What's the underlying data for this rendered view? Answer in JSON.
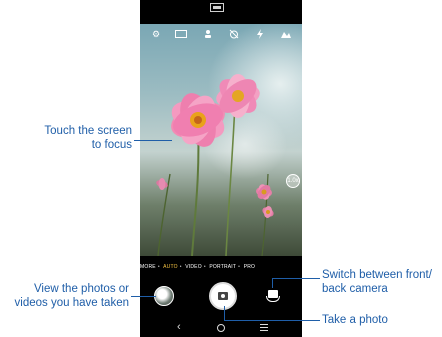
{
  "camera": {
    "toolbar_icons": [
      "gear-icon",
      "hdr-icon",
      "person-icon",
      "timer-off-icon",
      "flash-icon",
      "filter-icon"
    ],
    "zoom_label": "1.0x",
    "modes": [
      "MORE",
      "AUTO",
      "VIDEO",
      "PORTRAIT",
      "PRO"
    ],
    "active_mode": "AUTO",
    "nav": {
      "back": "‹"
    }
  },
  "callouts": {
    "focus_line1": "Touch the screen",
    "focus_line2": "to focus",
    "gallery_line1": "View the photos or",
    "gallery_line2": "videos you have taken",
    "switch_line1": "Switch between front/",
    "switch_line2": "back camera",
    "photo": "Take a photo"
  },
  "colors": {
    "callout": "#1f5ea8",
    "active_mode": "#f5c342"
  }
}
